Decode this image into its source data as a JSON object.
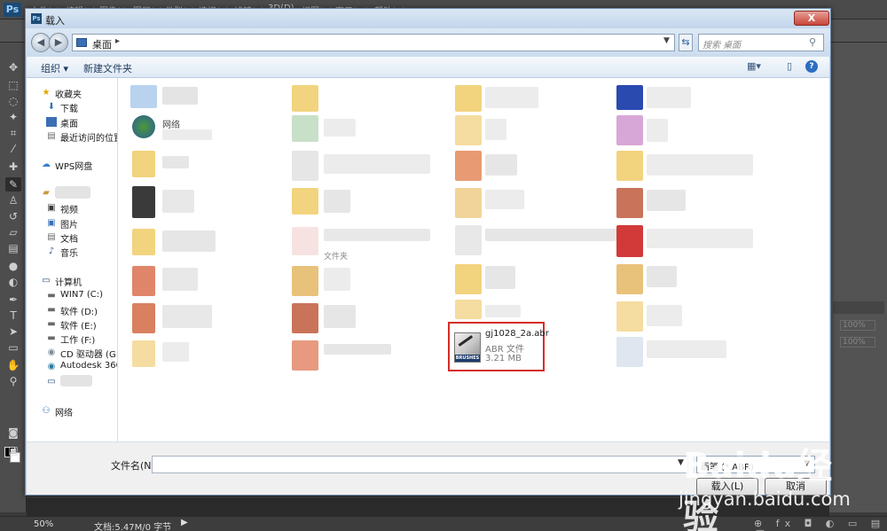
{
  "photoshop": {
    "logo": "Ps",
    "menus": [
      "文件(F)",
      "编辑(E)",
      "图像(I)",
      "图层(L)",
      "类型(Y)",
      "选择(S)",
      "滤镜(T)",
      "3D(D)",
      "视图(V)",
      "窗口(W)",
      "帮助(H)"
    ],
    "status": {
      "zoom": "50%",
      "doc": "文档:5.47M/0 字节"
    },
    "opacity_placeholder": "100%"
  },
  "dialog": {
    "title": "载入",
    "close_label": "X",
    "address_path": "桌面",
    "search_placeholder": "搜索 桌面",
    "toolbar": {
      "organize": "组织 ▾",
      "new_folder": "新建文件夹"
    },
    "nav": {
      "favorites": "收藏夹",
      "favorites_items": [
        "下载",
        "桌面",
        "最近访问的位置"
      ],
      "wps": "WPS网盘",
      "libraries_items": [
        "视频",
        "图片",
        "文档",
        "音乐"
      ],
      "computer": "计算机",
      "computer_items": [
        "WIN7 (C:)",
        "软件 (D:)",
        "软件 (E:)",
        "工作 (F:)",
        "CD 驱动器 (G:) I",
        "Autodesk 360"
      ],
      "network": "网络"
    },
    "visible_labels": {
      "network_item": "网络",
      "folder_type": "文件夹"
    },
    "selected_file": {
      "name": "gj1028_2a.abr",
      "type": "ABR 文件",
      "size": "3.21 MB",
      "icon_strip": "BRUSHES"
    },
    "filename_label": "文件名(N):",
    "filename_value": "",
    "filter_value": "画笔 (*.ABR)",
    "buttons": {
      "load": "载入(L)",
      "cancel": "取消"
    }
  },
  "watermark": {
    "logo": "Baidu经验",
    "url": "jingyan.baidu.com"
  },
  "colors": {
    "highlight": "#d52d28",
    "dialog_frame": "#bcd2ea",
    "ps_dark": "#3a3a3a"
  }
}
